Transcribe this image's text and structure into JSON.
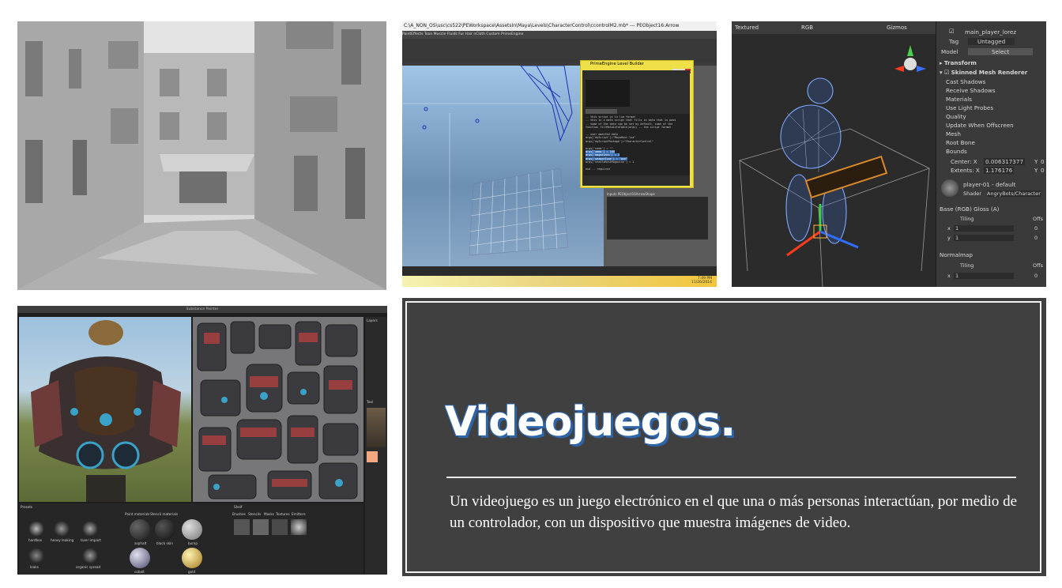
{
  "maya": {
    "title": "C:\\A_NON_OS\\usc\\cs522\\PEWorkspace\\AssetsIn\\Maya\\Levels\\CharacterControl\\ccontrolM2.mb* --- PEObject16:Arrow",
    "menu": "PaintEffects  Toon  Muscle  Fluids  Fur  Hair  nCloth  Custom  PrimeEngine",
    "dialog_title": "PrimeEngine Level Builder",
    "code_lines": [
      "-- this script is in lua format",
      "-- this is a meta script that fills in data that is pass",
      "-- some of the data can be set by default, some of the",
      "function fillMetaInfoTable(args) -- the script format",
      "",
      "-- user modifed data",
      "args['myScript']=\"MayaHost.lua\"",
      "args['myScriptPackage']=\"CharacterControl\"",
      "",
      "args['name'] = \"\"",
      "args['ammo'] = 100",
      "args['magazines'] = 3",
      "args['weaponType'] = \"gun\"",
      "args['needToRestMagazine'] = 1",
      "",
      "end -- required"
    ],
    "clock_time": "7:49 PM",
    "clock_date": "11/26/2014",
    "channel_box_label": "Inputs   PEObject16ArrowShape"
  },
  "unity": {
    "toolbar": [
      "Textured",
      "RGB",
      "Gizmos"
    ],
    "object_name": "main_player_lorez",
    "tag_label": "Tag",
    "tag_value": "Untagged",
    "model_label": "Model",
    "model_select": "Select",
    "transform": "Transform",
    "renderer": "Skinned Mesh Renderer",
    "props": [
      "Cast Shadows",
      "Receive Shadows",
      "Materials",
      "Use Light Probes",
      "Quality",
      "Update When Offscreen",
      "Mesh",
      "Root Bone",
      "Bounds"
    ],
    "center_label": "Center: X",
    "center_x": "0.006317377",
    "center_y_label": "Y",
    "center_y": "0",
    "extents_label": "Extents: X",
    "extents_x": "1.176176",
    "extents_y_label": "Y",
    "extents_y": "0",
    "material_name": "player-01 - default",
    "shader_label": "Shader",
    "shader_value": "AngryBots/Character",
    "base_tex": "Base (RGB) Gloss (A)",
    "tiling": "Tiling",
    "offset": "Offs",
    "x": "x",
    "y": "y",
    "one": "1",
    "zero": "0",
    "normalmap": "Normalmap"
  },
  "substance": {
    "title": "Substance Painter",
    "presets": "Presets",
    "shelf": "Shelf",
    "layers": "Layers",
    "tool": "Tool",
    "shelf_tabs": [
      "Brushes",
      "Stencils",
      "Masks",
      "Textures",
      "Emitters"
    ],
    "brush_names": [
      "hardbox",
      "heavy leaking",
      "laser impact",
      "leaks",
      "organic spread"
    ],
    "material_tabs": [
      "Paint materials",
      "Stencil materials"
    ],
    "material_names": [
      "asphalt",
      "black skin",
      "bump",
      "cobalt",
      "gold"
    ]
  },
  "card": {
    "title": "Videojuegos.",
    "body": "Un videojuego es un juego electrónico en el que una o más personas interactúan, por medio de un controlador, con un dispositivo que muestra imágenes de video.",
    "colors": {
      "background": "#404040",
      "title_outline": "#2e64a8",
      "frame": "#f2f2f2"
    }
  }
}
